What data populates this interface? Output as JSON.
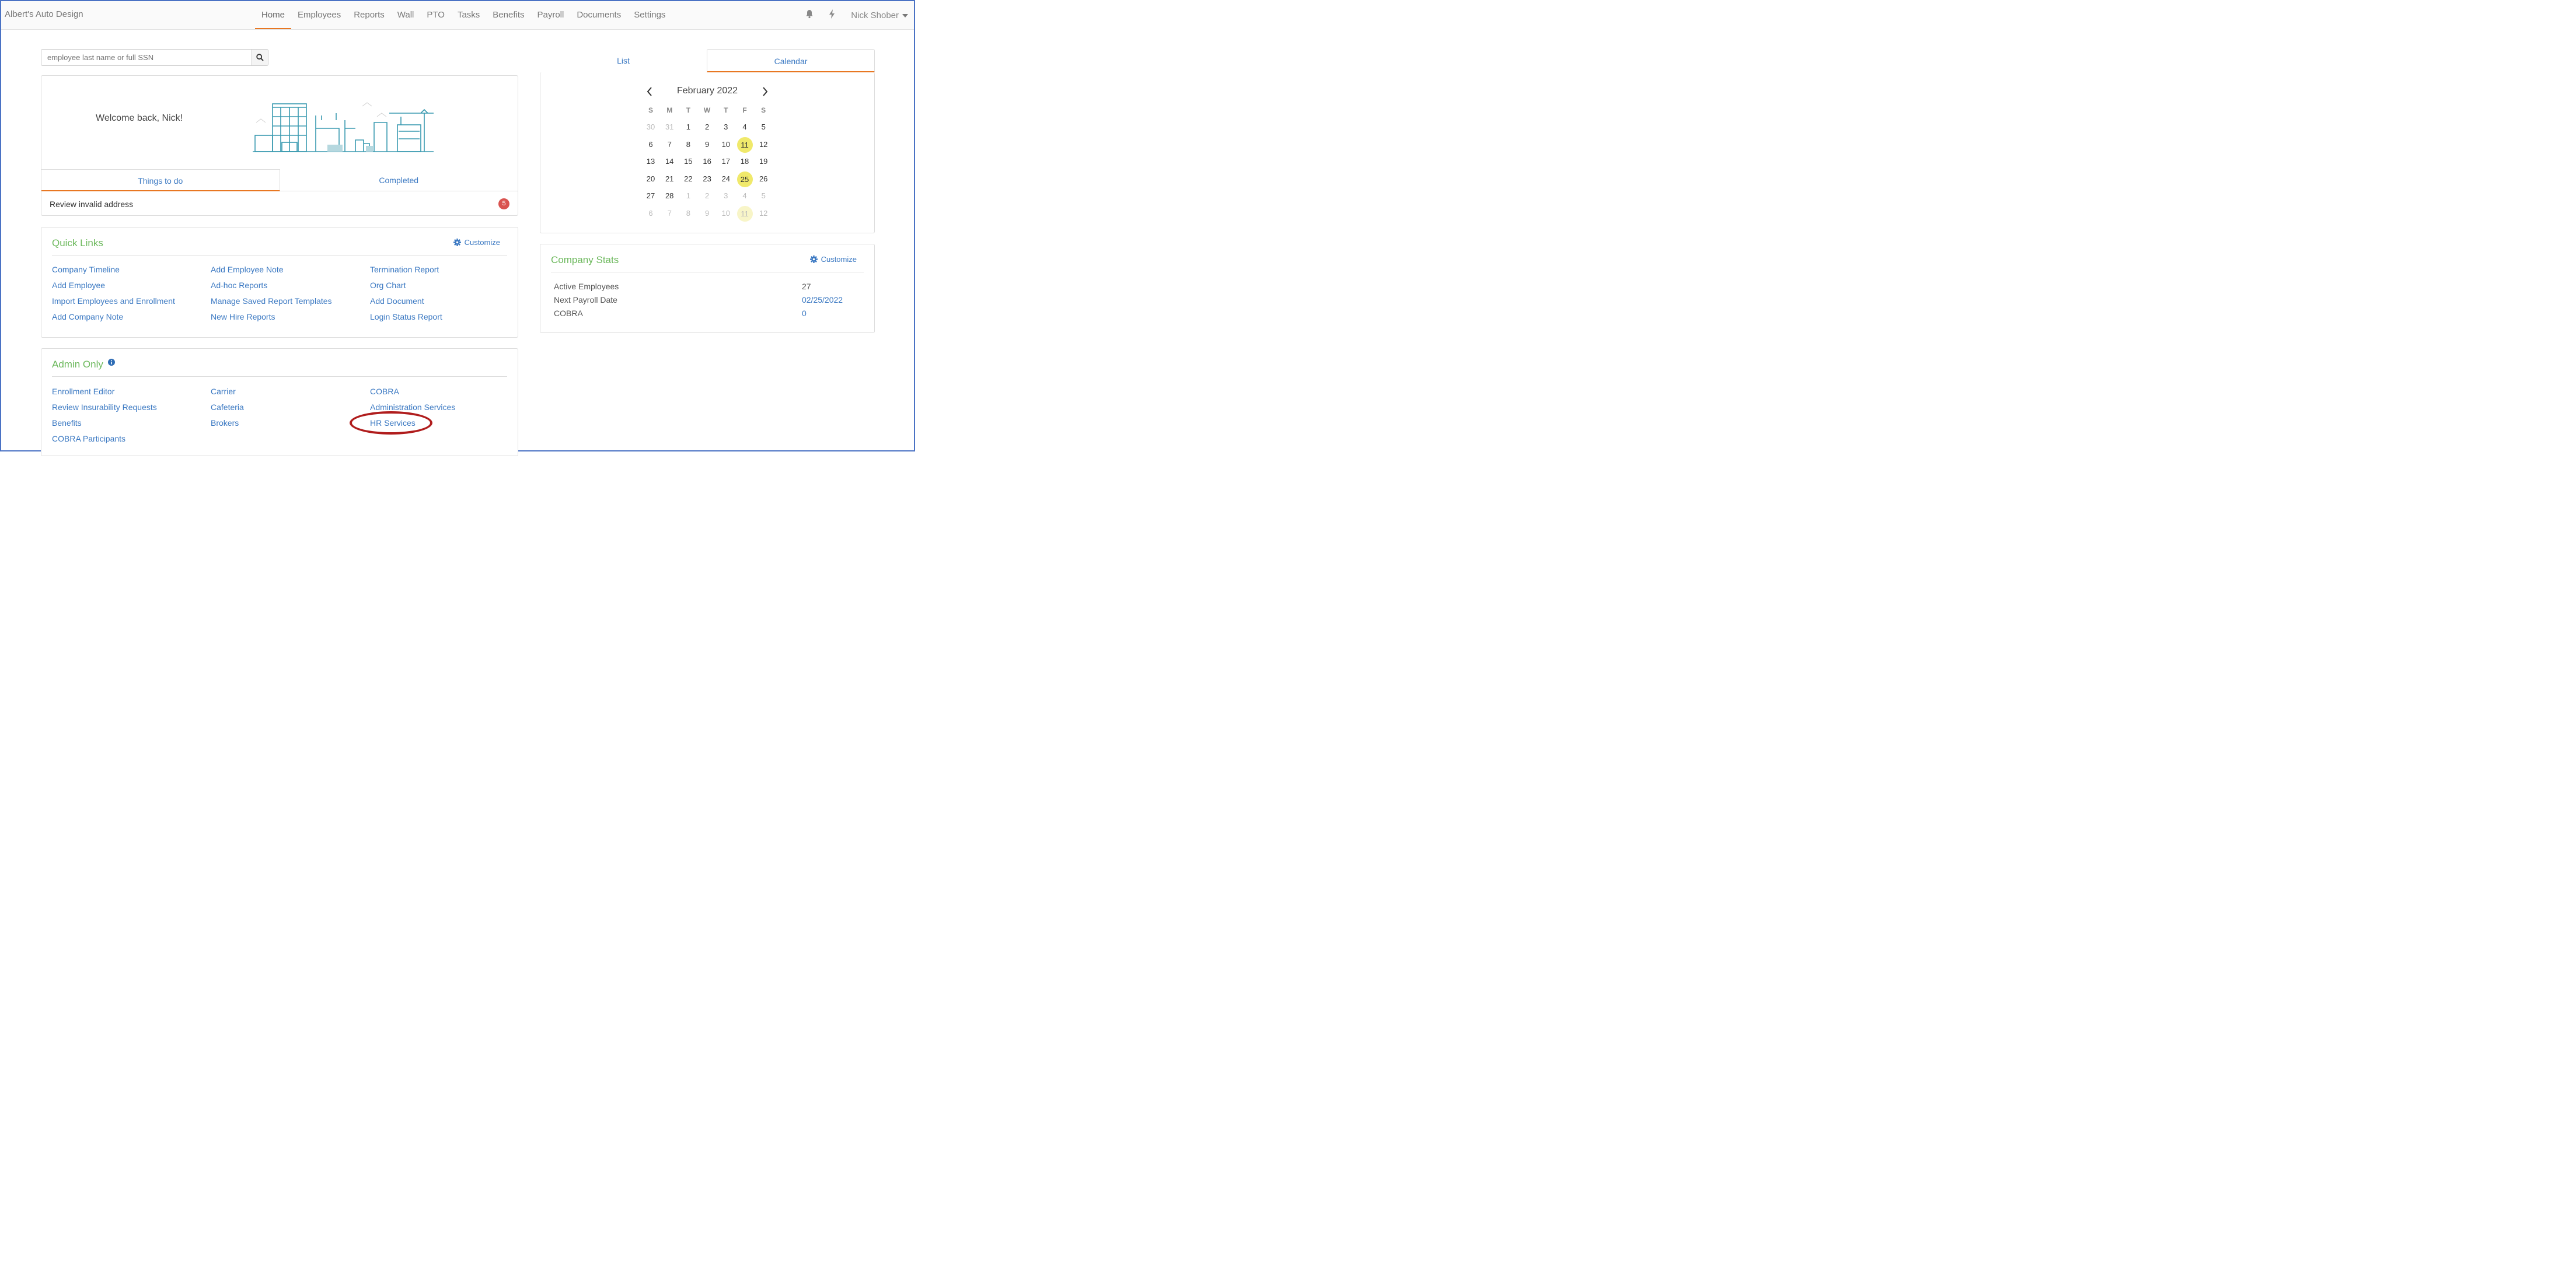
{
  "app": {
    "brand": "Albert's Auto Design"
  },
  "nav": {
    "items": [
      "Home",
      "Employees",
      "Reports",
      "Wall",
      "PTO",
      "Tasks",
      "Benefits",
      "Payroll",
      "Documents",
      "Settings"
    ],
    "active": "Home"
  },
  "user": {
    "name": "Nick Shober"
  },
  "search": {
    "placeholder": "employee last name or full SSN"
  },
  "welcome": {
    "message": "Welcome back, Nick!"
  },
  "todo_tabs": {
    "things_to_do": "Things to do",
    "completed": "Completed"
  },
  "todo": {
    "item": "Review invalid address",
    "count": "5"
  },
  "quick_links": {
    "title": "Quick Links",
    "customize": "Customize",
    "col1": [
      "Company Timeline",
      "Add Employee",
      "Import Employees and Enrollment",
      "Add Company Note"
    ],
    "col2": [
      "Add Employee Note",
      "Ad-hoc Reports",
      "Manage Saved Report Templates",
      "New Hire Reports"
    ],
    "col3": [
      "Termination Report",
      "Org Chart",
      "Add Document",
      "Login Status Report"
    ]
  },
  "admin_only": {
    "title": "Admin Only",
    "col1": [
      "Enrollment Editor",
      "Review Insurability Requests",
      "Benefits",
      "COBRA Participants"
    ],
    "col2": [
      "Carrier",
      "Cafeteria",
      "Brokers"
    ],
    "col3": [
      "COBRA",
      "Administration Services",
      "HR Services"
    ],
    "highlighted": "HR Services"
  },
  "right_tabs": {
    "list": "List",
    "calendar": "Calendar",
    "active": "Calendar"
  },
  "calendar": {
    "month": "February 2022",
    "dow": [
      "S",
      "M",
      "T",
      "W",
      "T",
      "F",
      "S"
    ],
    "weeks": [
      [
        [
          "30",
          "m"
        ],
        [
          "31",
          "m"
        ],
        [
          "1",
          ""
        ],
        [
          "2",
          ""
        ],
        [
          "3",
          ""
        ],
        [
          "4",
          ""
        ],
        [
          "5",
          ""
        ]
      ],
      [
        [
          "6",
          ""
        ],
        [
          "7",
          ""
        ],
        [
          "8",
          ""
        ],
        [
          "9",
          ""
        ],
        [
          "10",
          ""
        ],
        [
          "11",
          "h"
        ],
        [
          "12",
          ""
        ]
      ],
      [
        [
          "13",
          ""
        ],
        [
          "14",
          ""
        ],
        [
          "15",
          ""
        ],
        [
          "16",
          ""
        ],
        [
          "17",
          ""
        ],
        [
          "18",
          ""
        ],
        [
          "19",
          ""
        ]
      ],
      [
        [
          "20",
          ""
        ],
        [
          "21",
          ""
        ],
        [
          "22",
          ""
        ],
        [
          "23",
          ""
        ],
        [
          "24",
          ""
        ],
        [
          "25",
          "h"
        ],
        [
          "26",
          ""
        ]
      ],
      [
        [
          "27",
          ""
        ],
        [
          "28",
          ""
        ],
        [
          "1",
          "m"
        ],
        [
          "2",
          "m"
        ],
        [
          "3",
          "m"
        ],
        [
          "4",
          "m"
        ],
        [
          "5",
          "m"
        ]
      ],
      [
        [
          "6",
          "m"
        ],
        [
          "7",
          "m"
        ],
        [
          "8",
          "m"
        ],
        [
          "9",
          "m"
        ],
        [
          "10",
          "m"
        ],
        [
          "11",
          "mh"
        ],
        [
          "12",
          "m"
        ]
      ]
    ]
  },
  "company_stats": {
    "title": "Company Stats",
    "customize": "Customize",
    "rows": [
      {
        "label": "Active Employees",
        "value": "27",
        "link": false
      },
      {
        "label": "Next Payroll Date",
        "value": "02/25/2022",
        "link": true
      },
      {
        "label": "COBRA",
        "value": "0",
        "link": true
      }
    ]
  },
  "colors": {
    "accent": "#e87722",
    "link": "#3a78c2",
    "section": "#6cb85c",
    "badge": "#d9534f",
    "highlight": "#f0e96b",
    "annotation": "#b01c1c"
  }
}
